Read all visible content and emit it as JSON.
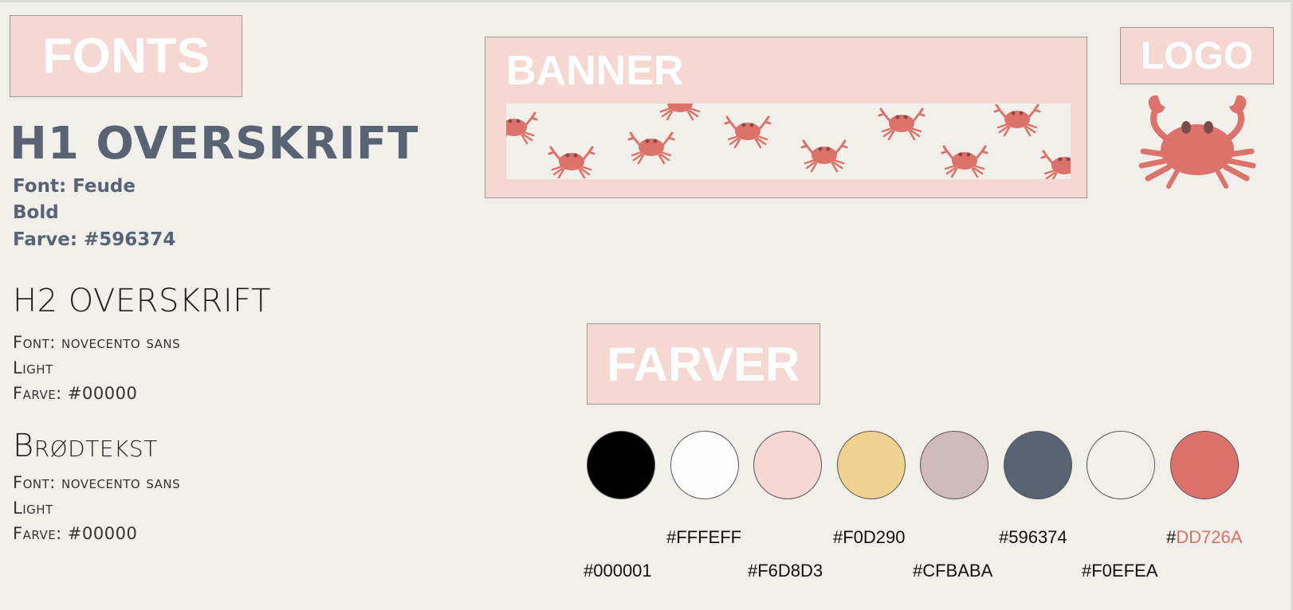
{
  "headings": {
    "fonts": "FONTS",
    "banner": "BANNER",
    "logo": "LOGO",
    "farver": "FARVER"
  },
  "h1": {
    "title": "H1 OVERSKRIFT",
    "font": "Font: Feude",
    "weight": "Bold",
    "color": "Farve: #596374"
  },
  "h2": {
    "title": "H2 OVERSKRIFT",
    "font": "Font: novecento sans",
    "weight": "Light",
    "color": "Farve: #00000"
  },
  "body_text": {
    "title": "Brødtekst",
    "font": "Font: novecento sans",
    "weight": "Light",
    "color": "Farve: #00000"
  },
  "swatches": [
    {
      "color": "#000001"
    },
    {
      "color": "#FFFEFF"
    },
    {
      "color": "#F6D8D3"
    },
    {
      "color": "#F0D290"
    },
    {
      "color": "#CFBABA"
    },
    {
      "color": "#596374"
    },
    {
      "color": "#F0EFEA"
    },
    {
      "color": "#DD726A"
    }
  ],
  "hex_labels": {
    "c1": "#000001",
    "c2": "#FFFEFF",
    "c3": "#F6D8D3",
    "c4": "#F0D290",
    "c5": "#CFBABA",
    "c6": "#596374",
    "c7": "#F0EFEA",
    "c8_hash": "#",
    "c8_code": "DD726A"
  },
  "icons": {
    "logo": "crab-icon",
    "banner_pattern": "crab-icon"
  }
}
